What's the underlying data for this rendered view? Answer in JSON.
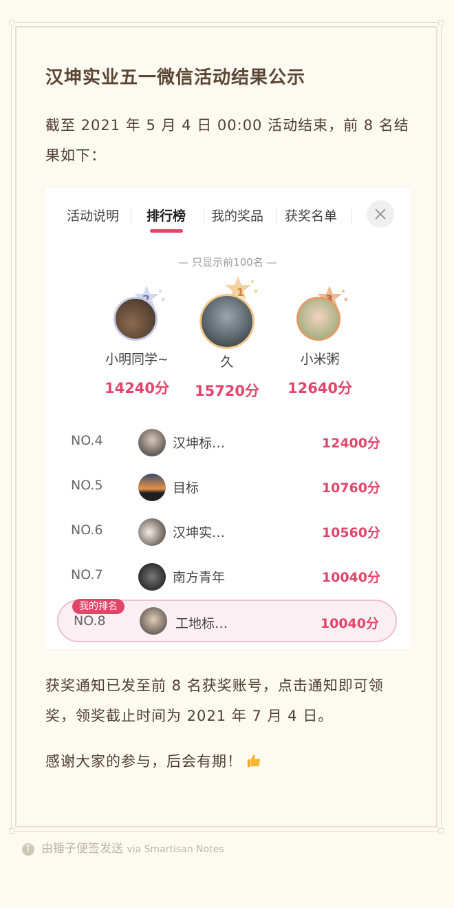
{
  "note": {
    "title": "汉坤实业五一微信活动结果公示",
    "intro": "截至 2021 年 5 月 4 日 00:00 活动结束，前 8 名结果如下：",
    "award_notice": "获奖通知已发至前 8 名获奖账号，点击通知即可领奖，领奖截止时间为 2021 年 7 月 4 日。",
    "thanks": "感谢大家的参与，后会有期！",
    "thanks_emoji": "thumbs-up-icon"
  },
  "leaderboard": {
    "tabs": [
      {
        "label": "活动说明",
        "active": false
      },
      {
        "label": "排行榜",
        "active": true
      },
      {
        "label": "我的奖品",
        "active": false
      },
      {
        "label": "获奖名单",
        "active": false
      }
    ],
    "close_icon": "close-icon",
    "display_note": "— 只显示前100名 —",
    "podium": [
      {
        "rank": "2",
        "name": "小明同学~",
        "score": "14240分",
        "color": "#c7cbe6"
      },
      {
        "rank": "1",
        "name": "久",
        "score": "15720分",
        "color": "#f2c98a"
      },
      {
        "rank": "3",
        "name": "小米粥",
        "score": "12640分",
        "color": "#e39b6a"
      }
    ],
    "rows": [
      {
        "rank": "NO.4",
        "name": "汉坤标…",
        "score": "12400分"
      },
      {
        "rank": "NO.5",
        "name": "目标",
        "score": "10760分"
      },
      {
        "rank": "NO.6",
        "name": "汉坤实…",
        "score": "10560分"
      },
      {
        "rank": "NO.7",
        "name": "南方青年",
        "score": "10040分"
      }
    ],
    "my_rank": {
      "badge": "我的排名",
      "rank": "NO.8",
      "name": "工地标…",
      "score": "10040分"
    },
    "accent_color": "#e2456a"
  },
  "footer": {
    "logo_letter": "T",
    "text": "由锤子便签发送",
    "via": "via Smartisan Notes"
  }
}
